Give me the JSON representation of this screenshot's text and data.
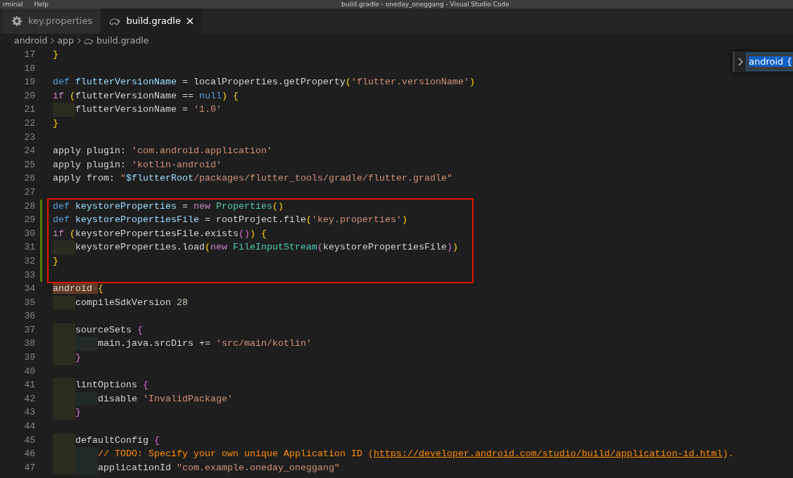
{
  "title_bar": {
    "menu": [
      "rminal",
      "Help"
    ],
    "title": "build.gradle - oneday_oneggang - Visual Studio Code"
  },
  "tabs": [
    {
      "label": "key.properties",
      "kind": "properties",
      "selected": false
    },
    {
      "label": "build.gradle",
      "kind": "gradle",
      "selected": true
    }
  ],
  "breadcrumb": [
    {
      "label": "android",
      "kind": "folder"
    },
    {
      "label": "app",
      "kind": "folder"
    },
    {
      "label": "build.gradle",
      "kind": "gradle"
    }
  ],
  "find_widget": {
    "value": "android {"
  },
  "lines": [
    {
      "number": "17",
      "modified": false,
      "boxed": false,
      "tokens": [
        {
          "kind": "bracket",
          "text": "}"
        }
      ]
    },
    {
      "number": "18",
      "modified": false,
      "boxed": false
    },
    {
      "number": "19",
      "modified": false,
      "boxed": false,
      "tokens": [
        {
          "kind": "keyword",
          "text": "def "
        },
        {
          "kind": "variable",
          "text": "flutterVersionName"
        },
        {
          "kind": "plain",
          "text": " = localProperties.getProperty"
        },
        {
          "kind": "bracket",
          "text": "("
        },
        {
          "kind": "string",
          "text": "'flutter.versionName'"
        },
        {
          "kind": "bracket",
          "text": ")"
        }
      ]
    },
    {
      "number": "20",
      "modified": false,
      "boxed": false,
      "tokens": [
        {
          "kind": "control",
          "text": "if "
        },
        {
          "kind": "bracket",
          "text": "("
        },
        {
          "kind": "plain",
          "text": "flutterVersionName == "
        },
        {
          "kind": "keyword",
          "text": "null"
        },
        {
          "kind": "bracket",
          "text": ") {"
        }
      ]
    },
    {
      "number": "21",
      "modified": false,
      "boxed": false,
      "tokens": [
        {
          "kind": "plain",
          "text": "    flutterVersionName = "
        },
        {
          "kind": "string",
          "text": "'1.0'"
        }
      ]
    },
    {
      "number": "22",
      "modified": false,
      "boxed": false,
      "tokens": [
        {
          "kind": "bracket",
          "text": "}"
        }
      ]
    },
    {
      "number": "23",
      "modified": false,
      "boxed": false
    },
    {
      "number": "24",
      "modified": false,
      "boxed": false,
      "tokens": [
        {
          "kind": "plain",
          "text": "apply plugin: "
        },
        {
          "kind": "string",
          "text": "'com.android.application'"
        }
      ]
    },
    {
      "number": "25",
      "modified": false,
      "boxed": false,
      "tokens": [
        {
          "kind": "plain",
          "text": "apply plugin: "
        },
        {
          "kind": "string",
          "text": "'kotlin-android'"
        }
      ]
    },
    {
      "number": "26",
      "modified": false,
      "boxed": false,
      "tokens": [
        {
          "kind": "plain",
          "text": "apply from: "
        },
        {
          "kind": "string",
          "text": "\""
        },
        {
          "kind": "variable",
          "text": "$flutterRoot"
        },
        {
          "kind": "string",
          "text": "/packages/flutter_tools/gradle/flutter.gradle\""
        }
      ]
    },
    {
      "number": "27",
      "modified": false,
      "boxed": false
    },
    {
      "number": "28",
      "modified": true,
      "boxed": true,
      "tokens": [
        {
          "kind": "keyword",
          "text": "def "
        },
        {
          "kind": "variable",
          "text": "keystoreProperties"
        },
        {
          "kind": "plain",
          "text": " = "
        },
        {
          "kind": "control",
          "text": "new "
        },
        {
          "kind": "class",
          "text": "Properties"
        },
        {
          "kind": "bracket",
          "text": "()"
        }
      ]
    },
    {
      "number": "29",
      "modified": true,
      "boxed": true,
      "tokens": [
        {
          "kind": "keyword",
          "text": "def "
        },
        {
          "kind": "variable",
          "text": "keystorePropertiesFile"
        },
        {
          "kind": "plain",
          "text": " = rootProject.file"
        },
        {
          "kind": "bracket",
          "text": "("
        },
        {
          "kind": "string",
          "text": "'key.properties'"
        },
        {
          "kind": "bracket",
          "text": ")"
        }
      ]
    },
    {
      "number": "30",
      "modified": true,
      "boxed": true,
      "tokens": [
        {
          "kind": "control",
          "text": "if "
        },
        {
          "kind": "bracket",
          "text": "("
        },
        {
          "kind": "plain",
          "text": "keystorePropertiesFile.exists"
        },
        {
          "kind": "bracket2",
          "text": "()"
        },
        {
          "kind": "bracket",
          "text": ") {"
        }
      ]
    },
    {
      "number": "31",
      "modified": true,
      "boxed": true,
      "tokens": [
        {
          "kind": "plain",
          "text": "    keystoreProperties.load"
        },
        {
          "kind": "bracket",
          "text": "("
        },
        {
          "kind": "control",
          "text": "new "
        },
        {
          "kind": "class",
          "text": "FileInputStream"
        },
        {
          "kind": "bracket2",
          "text": "("
        },
        {
          "kind": "plain",
          "text": "keystorePropertiesFile"
        },
        {
          "kind": "bracket2",
          "text": ")"
        },
        {
          "kind": "bracket",
          "text": ")"
        }
      ]
    },
    {
      "number": "32",
      "modified": true,
      "boxed": true,
      "tokens": [
        {
          "kind": "bracket",
          "text": "}"
        }
      ]
    },
    {
      "number": "33",
      "modified": true,
      "boxed": true
    },
    {
      "number": "34",
      "modified": false,
      "boxed": false,
      "tokens": [
        {
          "kind": "match",
          "text": "android"
        },
        {
          "kind": "whitespace",
          "text": "·"
        },
        {
          "kind": "bracket",
          "text": "{"
        }
      ]
    },
    {
      "number": "35",
      "modified": false,
      "boxed": false,
      "tokens": [
        {
          "kind": "plain",
          "text": "    compileSdkVersion "
        },
        {
          "kind": "number",
          "text": "28"
        }
      ]
    },
    {
      "number": "36",
      "modified": false,
      "boxed": false
    },
    {
      "number": "37",
      "modified": false,
      "boxed": false,
      "tokens": [
        {
          "kind": "plain",
          "text": "    sourceSets "
        },
        {
          "kind": "bracket2",
          "text": "{"
        }
      ]
    },
    {
      "number": "38",
      "modified": false,
      "boxed": false,
      "tokens": [
        {
          "kind": "plain",
          "text": "        main.java.srcDirs += "
        },
        {
          "kind": "string",
          "text": "'src/main/kotlin'"
        }
      ]
    },
    {
      "number": "39",
      "modified": false,
      "boxed": false,
      "tokens": [
        {
          "kind": "bracket2",
          "text": "    }"
        }
      ]
    },
    {
      "number": "40",
      "modified": false,
      "boxed": false
    },
    {
      "number": "41",
      "modified": false,
      "boxed": false,
      "tokens": [
        {
          "kind": "plain",
          "text": "    lintOptions "
        },
        {
          "kind": "bracket2",
          "text": "{"
        }
      ]
    },
    {
      "number": "42",
      "modified": false,
      "boxed": false,
      "tokens": [
        {
          "kind": "plain",
          "text": "        disable "
        },
        {
          "kind": "string",
          "text": "'InvalidPackage'"
        }
      ]
    },
    {
      "number": "43",
      "modified": false,
      "boxed": false,
      "tokens": [
        {
          "kind": "bracket2",
          "text": "    }"
        }
      ]
    },
    {
      "number": "44",
      "modified": false,
      "boxed": false
    },
    {
      "number": "45",
      "modified": false,
      "boxed": false,
      "tokens": [
        {
          "kind": "plain",
          "text": "    defaultConfig "
        },
        {
          "kind": "bracket2",
          "text": "{"
        }
      ]
    },
    {
      "number": "46",
      "modified": false,
      "boxed": false,
      "tokens": [
        {
          "kind": "comment",
          "text": "        // TODO: Specify your own unique Application ID ("
        },
        {
          "kind": "link",
          "text": "https://developer.android.com/studio/build/application-id.html"
        },
        {
          "kind": "comment",
          "text": ")."
        }
      ]
    },
    {
      "number": "47",
      "modified": false,
      "boxed": false,
      "tokens": [
        {
          "kind": "plain",
          "text": "        applicationId "
        },
        {
          "kind": "string",
          "text": "\"com.example.oneday_oneggang\""
        }
      ]
    }
  ]
}
